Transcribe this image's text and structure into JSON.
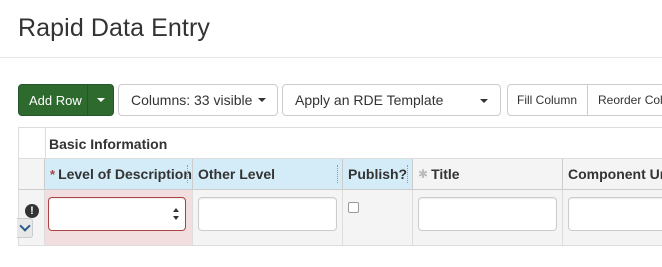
{
  "dialog": {
    "title": "Rapid Data Entry"
  },
  "toolbar": {
    "add_row_label": "Add Row",
    "columns_label": "Columns: 33 visible",
    "template_select_value": "Apply an RDE Template",
    "fill_column_label": "Fill Column",
    "reorder_columns_label": "Reorder Columns"
  },
  "grid": {
    "section_title": "Basic Information",
    "columns": [
      {
        "label": "Level of Description",
        "required": true
      },
      {
        "label": "Other Level"
      },
      {
        "label": "Publish?"
      },
      {
        "label": "Title"
      },
      {
        "label": "Component Unique Identifier"
      }
    ],
    "row": {
      "level_value": "",
      "other_level_value": "",
      "publish_checked": false,
      "title_value": "",
      "component_id_value": ""
    },
    "required_marker": "*",
    "alert_glyph": "!",
    "colors": {
      "required_header_bg": "#d4ecf7",
      "error_cell_bg": "#f2dede",
      "error_border": "#a94442",
      "primary_button": "#2e6a2e"
    }
  }
}
